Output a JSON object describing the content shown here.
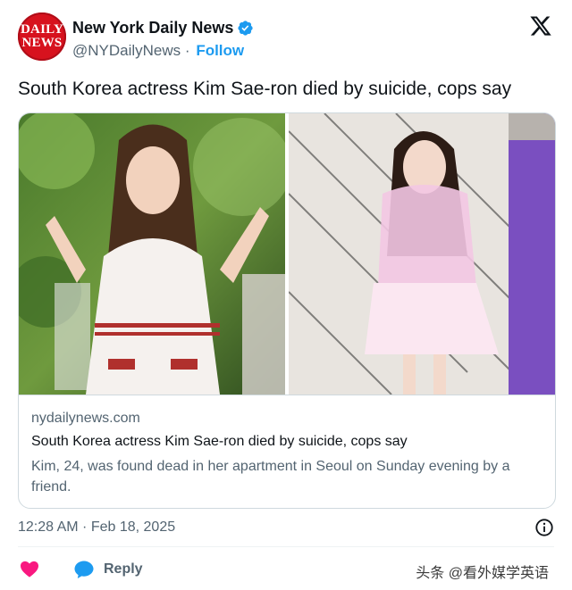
{
  "account": {
    "avatar_lines": [
      "DAILY",
      "NEWS"
    ],
    "display_name": "New York Daily News",
    "handle": "@NYDailyNews",
    "separator": "·",
    "follow_label": "Follow",
    "verified_color": "#1d9bf0"
  },
  "tweet": {
    "text": "South Korea actress Kim Sae-ron died by suicide, cops say"
  },
  "link_card": {
    "domain": "nydailynews.com",
    "title": "South Korea actress Kim Sae-ron died by suicide, cops say",
    "description": "Kim, 24, was found dead in her apartment in Seoul on Sunday evening by a friend."
  },
  "meta": {
    "timestamp": "12:28 AM · Feb 18, 2025"
  },
  "actions": {
    "reply_label": "Reply",
    "like_color": "#f91880",
    "reply_color": "#1d9bf0"
  },
  "watermark": "头条 @看外媒学英语",
  "icons": [
    "verified-badge-icon",
    "x-logo-icon",
    "info-icon",
    "heart-icon",
    "reply-bubble-icon"
  ]
}
